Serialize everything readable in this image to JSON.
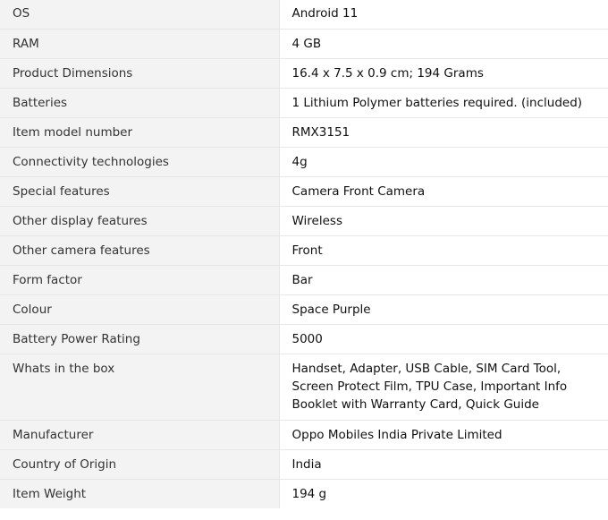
{
  "specs": [
    {
      "label": "OS",
      "value": "Android 11"
    },
    {
      "label": "RAM",
      "value": "4 GB"
    },
    {
      "label": "Product Dimensions",
      "value": "16.4 x 7.5 x 0.9 cm; 194 Grams"
    },
    {
      "label": "Batteries",
      "value": "1 Lithium Polymer batteries required. (included)"
    },
    {
      "label": "Item model number",
      "value": "RMX3151"
    },
    {
      "label": "Connectivity technologies",
      "value": "4g"
    },
    {
      "label": "Special features",
      "value": "Camera Front Camera"
    },
    {
      "label": "Other display features",
      "value": "Wireless"
    },
    {
      "label": "Other camera features",
      "value": "Front"
    },
    {
      "label": "Form factor",
      "value": "Bar"
    },
    {
      "label": "Colour",
      "value": "Space Purple"
    },
    {
      "label": "Battery Power Rating",
      "value": "5000"
    },
    {
      "label": "Whats in the box",
      "value": "Handset, Adapter, USB Cable, SIM Card Tool, Screen Protect Film, TPU Case, Important Info Booklet with Warranty Card, Quick Guide"
    },
    {
      "label": "Manufacturer",
      "value": "Oppo Mobiles India Private Limited"
    },
    {
      "label": "Country of Origin",
      "value": "India"
    },
    {
      "label": "Item Weight",
      "value": "194 g"
    }
  ]
}
